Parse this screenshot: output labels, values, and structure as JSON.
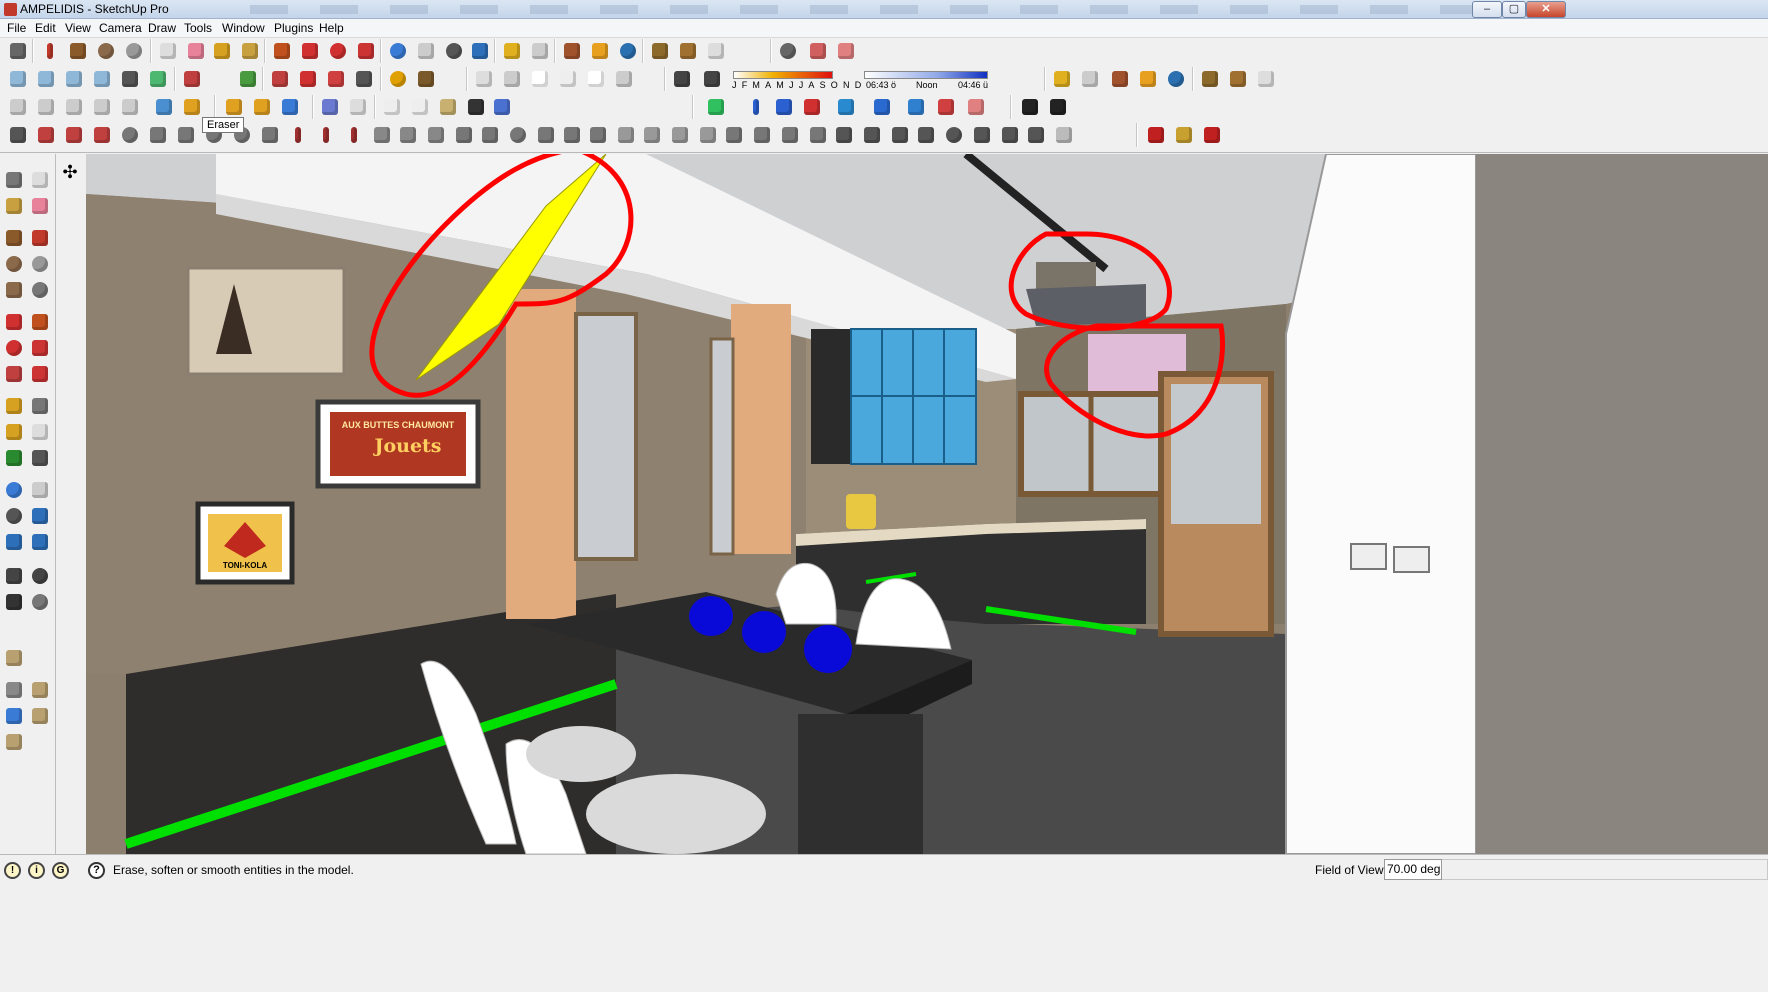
{
  "window": {
    "title": "AMPELIDIS - SketchUp Pro"
  },
  "menu": [
    "File",
    "Edit",
    "View",
    "Camera",
    "Draw",
    "Tools",
    "Window",
    "Plugins",
    "Help"
  ],
  "tooltip": {
    "text": "Eraser"
  },
  "shadow_settings": {
    "months": "JFMAMJJASOND",
    "time_start": "06:43 ö",
    "noon_label": "Noon",
    "time_end": "04:46 ü"
  },
  "scene": {
    "posters": [
      {
        "text": "AUX BUTTES CHAUMONT"
      },
      {
        "text": "Jouets"
      },
      {
        "text": "TONI-KOLA"
      }
    ]
  },
  "status": {
    "hint": "Erase, soften or smooth entities in the model.",
    "vcb_label": "Field of View",
    "vcb_value": "70.00 deg."
  },
  "annotations": {
    "stroke_color": "#ff0000",
    "count": 3
  },
  "colors": {
    "accent_yellow": "#ffff00",
    "cabinet_blue": "#4aa8dc",
    "led_green": "#00e000",
    "pink_panel": "#e0bcd8"
  }
}
